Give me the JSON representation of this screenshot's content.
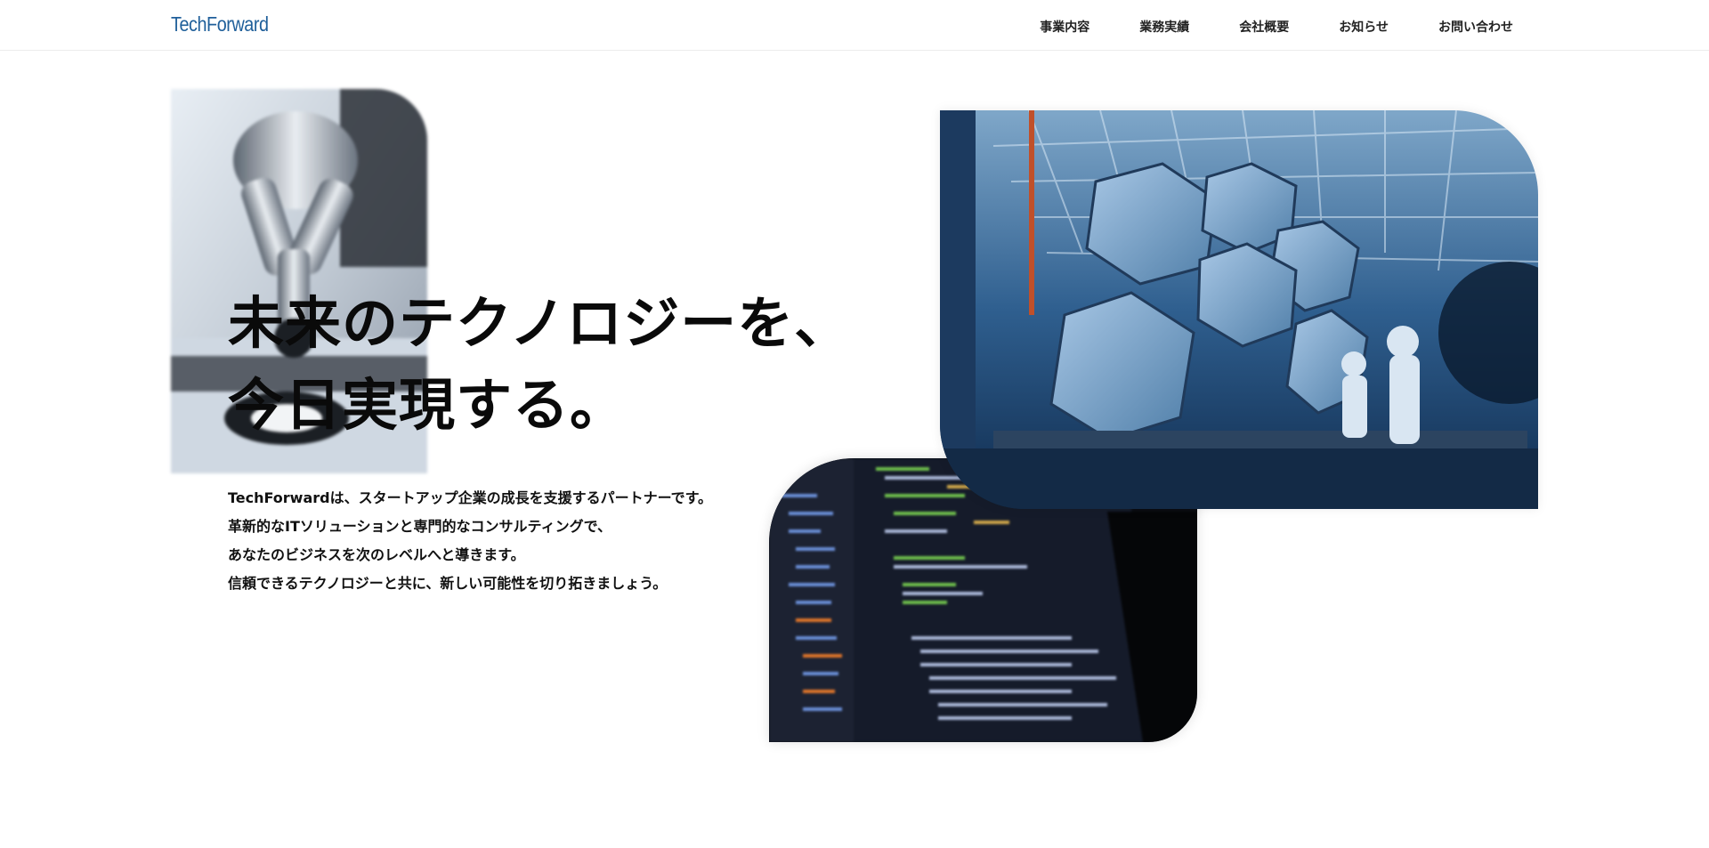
{
  "header": {
    "logo": "TechForward",
    "nav": [
      {
        "label": "事業内容"
      },
      {
        "label": "業務実績"
      },
      {
        "label": "会社概要"
      },
      {
        "label": "お知らせ"
      },
      {
        "label": "お問い合わせ"
      }
    ]
  },
  "hero": {
    "headline_line1": "未来のテクノロジーを、",
    "headline_line2": "今日実現する。",
    "description": [
      "TechForwardは、スタートアップ企業の成長を支援するパートナーです。",
      "革新的なITソリューションと専門的なコンサルティングで、",
      "あなたのビジネスを次のレベルへと導きます。",
      "信頼できるテクノロジーと共に、新しい可能性を切り拓きましょう。"
    ],
    "images": [
      {
        "name": "microscope",
        "icon": "microscope-photo"
      },
      {
        "name": "code-laptop",
        "icon": "code-editor-photo"
      },
      {
        "name": "telescope-mirrors",
        "icon": "telescope-photo"
      }
    ]
  },
  "colors": {
    "brand": "#1f5f9a",
    "text": "#111111",
    "background": "#ffffff"
  }
}
